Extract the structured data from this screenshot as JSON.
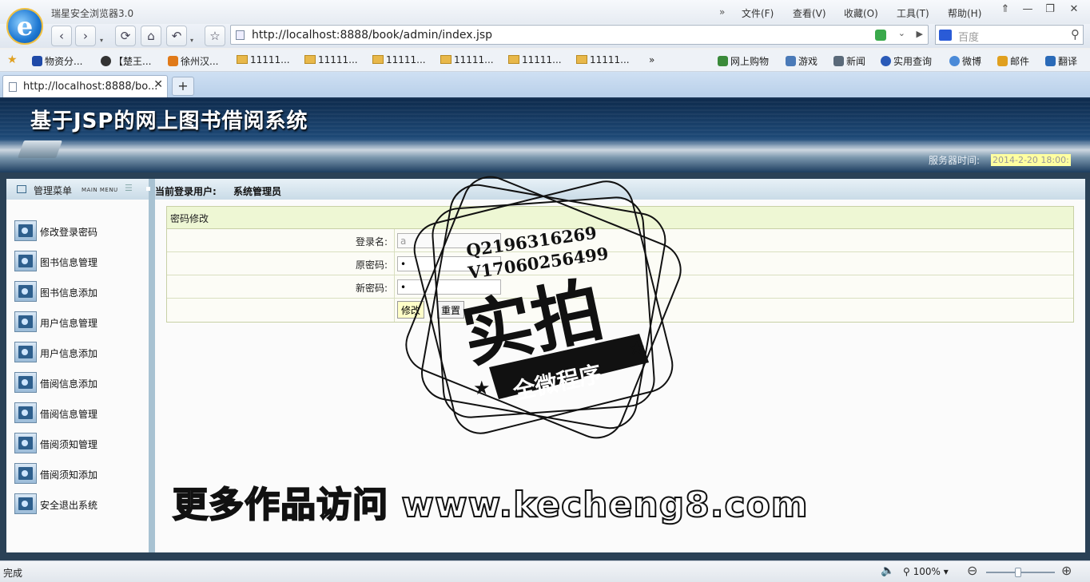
{
  "browser": {
    "app_title": "瑞星安全浏览器3.0",
    "logo_letter": "e",
    "menus": [
      "文件(F)",
      "查看(V)",
      "收藏(O)",
      "工具(T)",
      "帮助(H)"
    ],
    "menu_more": "»",
    "window_buttons": [
      "⇑",
      "—",
      "❐",
      "✕"
    ],
    "nav": {
      "back": "‹",
      "forward": "›",
      "refresh": "⟳",
      "home": "⌂",
      "undo": "↶",
      "favorite": "☆",
      "dropdown": "▾"
    },
    "address": "http://localhost:8888/book/admin/index.jsp",
    "address_dropdown": "⌄",
    "address_go": "▶",
    "search_placeholder": "百度",
    "search_icon_glyph": "⚲",
    "bookmarks": [
      {
        "label": "物资分...",
        "icon": "paw-icon",
        "color": "#1f4aa8"
      },
      {
        "label": "【楚王...",
        "icon": "chrome-icon",
        "color": "#333333"
      },
      {
        "label": "徐州汉...",
        "icon": "fox-icon",
        "color": "#e07a1a"
      },
      {
        "label": "11111...",
        "icon": "folder-icon",
        "color": "#e8b84a"
      },
      {
        "label": "11111...",
        "icon": "folder-icon",
        "color": "#e8b84a"
      },
      {
        "label": "11111...",
        "icon": "folder-icon",
        "color": "#e8b84a"
      },
      {
        "label": "11111...",
        "icon": "folder-icon",
        "color": "#e8b84a"
      },
      {
        "label": "11111...",
        "icon": "folder-icon",
        "color": "#e8b84a"
      },
      {
        "label": "11111...",
        "icon": "folder-icon",
        "color": "#e8b84a"
      }
    ],
    "bookmark_more": "»",
    "quick_links": [
      {
        "label": "网上购物",
        "icon": "cart-icon",
        "color": "#3a8a3a"
      },
      {
        "label": "游戏",
        "icon": "game-icon",
        "color": "#4a7ab8"
      },
      {
        "label": "新闻",
        "icon": "news-icon",
        "color": "#5a6a7a"
      },
      {
        "label": "实用查询",
        "icon": "search-icon",
        "color": "#2a5ab8"
      },
      {
        "label": "微博",
        "icon": "weibo-icon",
        "color": "#4a8ad8"
      },
      {
        "label": "邮件",
        "icon": "mail-icon",
        "color": "#e0a020"
      },
      {
        "label": "翻译",
        "icon": "translate-icon",
        "color": "#2a6ab8"
      }
    ],
    "tab_title": "http://localhost:8888/bo...",
    "tab_close": "✕",
    "new_tab": "+",
    "status": "完成",
    "zoom": "100%",
    "zoom_dd": "▾",
    "zoom_minus": "⊖",
    "zoom_plus": "⊕"
  },
  "app": {
    "title": "基于JSP的网上图书借阅系统",
    "server_time_label": "服务器时间:",
    "server_time": "2014-2-20 18:00:",
    "menu_title": "管理菜单",
    "menu_title_en": "MAIN MENU",
    "menu_lines": "☰",
    "login_user_label": "当前登录用户:",
    "login_user": "系统管理员",
    "menu_items": [
      "修改登录密码",
      "图书信息管理",
      "图书信息添加",
      "用户信息管理",
      "用户信息添加",
      "借阅信息添加",
      "借阅信息管理",
      "借阅须知管理",
      "借阅须知添加",
      "安全退出系统"
    ]
  },
  "form": {
    "title": "密码修改",
    "fields": [
      {
        "label": "登录名:",
        "value": "a"
      },
      {
        "label": "原密码:",
        "value": "•"
      },
      {
        "label": "新密码:",
        "value": "•"
      }
    ],
    "submit": "修改",
    "reset": "重置"
  },
  "overlay": {
    "contact1": "Q2196316269",
    "contact2": "V17060256499",
    "stamp_main": "实拍",
    "stamp_ribbon": "全微程序",
    "watermark": "更多作品访问 www.kecheng8.com"
  }
}
